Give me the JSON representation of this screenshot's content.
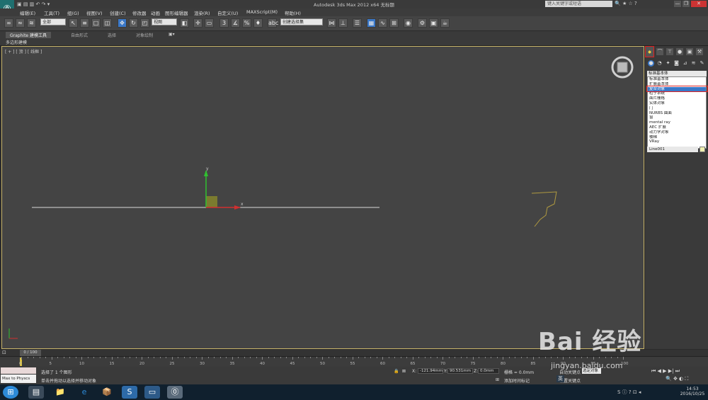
{
  "window": {
    "title": "Autodesk 3ds Max  2012 x64    无标题",
    "search_placeholder": "键入关键字或短语",
    "controls": [
      "—",
      "❐",
      "✕"
    ]
  },
  "menu": {
    "items": [
      "编辑(E)",
      "工具(T)",
      "组(G)",
      "视图(V)",
      "创建(C)",
      "修改器",
      "动画",
      "图形编辑器",
      "渲染(R)",
      "自定义(U)",
      "MAXScript(M)",
      "帮助(H)"
    ]
  },
  "toolbar": {
    "selection_filter": "全部",
    "reference_coord": "视图",
    "named_selection": "创建选择集"
  },
  "ribbon": {
    "tabs": [
      "Graphite 建模工具",
      "自由形式",
      "选择",
      "对象绘制"
    ],
    "sub_label": "多边形建模"
  },
  "viewport": {
    "label": "[ + ] [ 顶 ] [ 线框 ]",
    "axis_x": "x",
    "axis_y": "y"
  },
  "command_panel": {
    "dropdown_value": "标准基本体",
    "category_list": [
      "标准基本体",
      "扩展基本体",
      "复合对象",
      "粒子系统",
      "面片栅格",
      "实体对象",
      "门",
      "NURBS 曲面",
      "窗",
      "mental ray",
      "AEC 扩展",
      "动力学对象",
      "楼梯",
      "VRay"
    ],
    "selected_index": 2,
    "object_name": "Line001",
    "object_color": "#f0f0b0"
  },
  "timeline": {
    "frame_counter": "0 / 100",
    "ticks": [
      "0",
      "5",
      "10",
      "15",
      "20",
      "25",
      "30",
      "35",
      "40",
      "45",
      "50",
      "55",
      "60",
      "65",
      "70",
      "75",
      "80",
      "85",
      "90",
      "95",
      "100"
    ]
  },
  "statusbar": {
    "maxscript_text": "Max to Physcs",
    "selection_status": "选择了 1 个图形",
    "prompt": "单击并拖动以选择并移动对象",
    "x_label": "X:",
    "x_value": "-121.94mm",
    "y_label": "Y:",
    "y_value": "90.531mm",
    "z_label": "Z:",
    "z_value": "0.0mm",
    "grid": "栅格 = 0.0mm",
    "add_time_tag": "添加时间标记",
    "auto_key": "自动关键点",
    "set_key": "设置关键点"
  },
  "taskbar": {
    "time": "14:53",
    "date": "2016/10/25",
    "ime": "英"
  },
  "watermark": {
    "text": "Bai 经验",
    "url": "jingyan.baidu.com"
  }
}
